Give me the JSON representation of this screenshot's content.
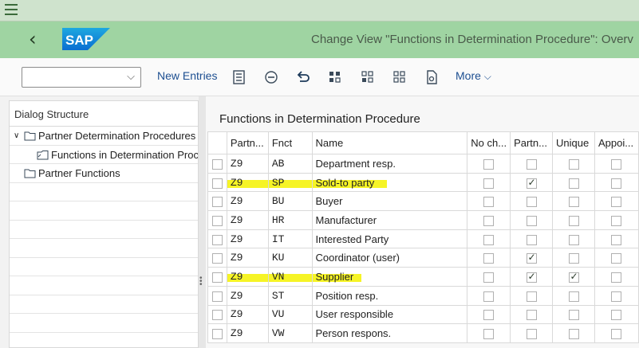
{
  "window": {
    "title": "Change View \"Functions in Determination Procedure\": Overv"
  },
  "shell": {
    "logo_text": "SAP"
  },
  "toolbar": {
    "combo_value": "",
    "new_entries": "New Entries",
    "more": "More"
  },
  "sidebar": {
    "header": "Dialog Structure",
    "items": [
      {
        "label": "Partner Determination Procedures"
      },
      {
        "label": "Functions in Determination Proc"
      },
      {
        "label": "Partner Functions"
      }
    ]
  },
  "content": {
    "title": "Functions in Determination Procedure",
    "columns": [
      "Partn...",
      "Fnct",
      "Name",
      "No ch...",
      "Partn...",
      "Unique",
      "Appoi..."
    ],
    "rows": [
      {
        "partn": "Z9",
        "fnct": "AB",
        "name": "Department resp.",
        "no_ch": false,
        "partn2": false,
        "unique": false,
        "appoi": false,
        "highlight": false
      },
      {
        "partn": "Z9",
        "fnct": "SP",
        "name": "Sold-to party",
        "no_ch": false,
        "partn2": true,
        "unique": false,
        "appoi": false,
        "highlight": true
      },
      {
        "partn": "Z9",
        "fnct": "BU",
        "name": "Buyer",
        "no_ch": false,
        "partn2": false,
        "unique": false,
        "appoi": false,
        "highlight": false
      },
      {
        "partn": "Z9",
        "fnct": "HR",
        "name": "Manufacturer",
        "no_ch": false,
        "partn2": false,
        "unique": false,
        "appoi": false,
        "highlight": false
      },
      {
        "partn": "Z9",
        "fnct": "IT",
        "name": "Interested Party",
        "no_ch": false,
        "partn2": false,
        "unique": false,
        "appoi": false,
        "highlight": false
      },
      {
        "partn": "Z9",
        "fnct": "KU",
        "name": "Coordinator (user)",
        "no_ch": false,
        "partn2": true,
        "unique": false,
        "appoi": false,
        "highlight": false
      },
      {
        "partn": "Z9",
        "fnct": "VN",
        "name": "Supplier",
        "no_ch": false,
        "partn2": true,
        "unique": true,
        "appoi": false,
        "highlight": true
      },
      {
        "partn": "Z9",
        "fnct": "ST",
        "name": "Position resp.",
        "no_ch": false,
        "partn2": false,
        "unique": false,
        "appoi": false,
        "highlight": false
      },
      {
        "partn": "Z9",
        "fnct": "VU",
        "name": "User responsible",
        "no_ch": false,
        "partn2": false,
        "unique": false,
        "appoi": false,
        "highlight": false
      },
      {
        "partn": "Z9",
        "fnct": "VW",
        "name": "Person respons.",
        "no_ch": false,
        "partn2": false,
        "unique": false,
        "appoi": false,
        "highlight": false
      }
    ]
  },
  "colors": {
    "shell": "#9fd4a2",
    "topbar": "#cfe3cd",
    "highlight": "#f5f200",
    "link": "#1d4f91"
  },
  "icons": [
    "menu-icon",
    "back-icon",
    "sap-logo",
    "details-icon",
    "delete-icon",
    "undo-icon",
    "select-all-icon",
    "select-block-icon",
    "deselect-all-icon",
    "print-icon",
    "chevron-down-icon",
    "folder-icon",
    "folder-open-icon"
  ]
}
